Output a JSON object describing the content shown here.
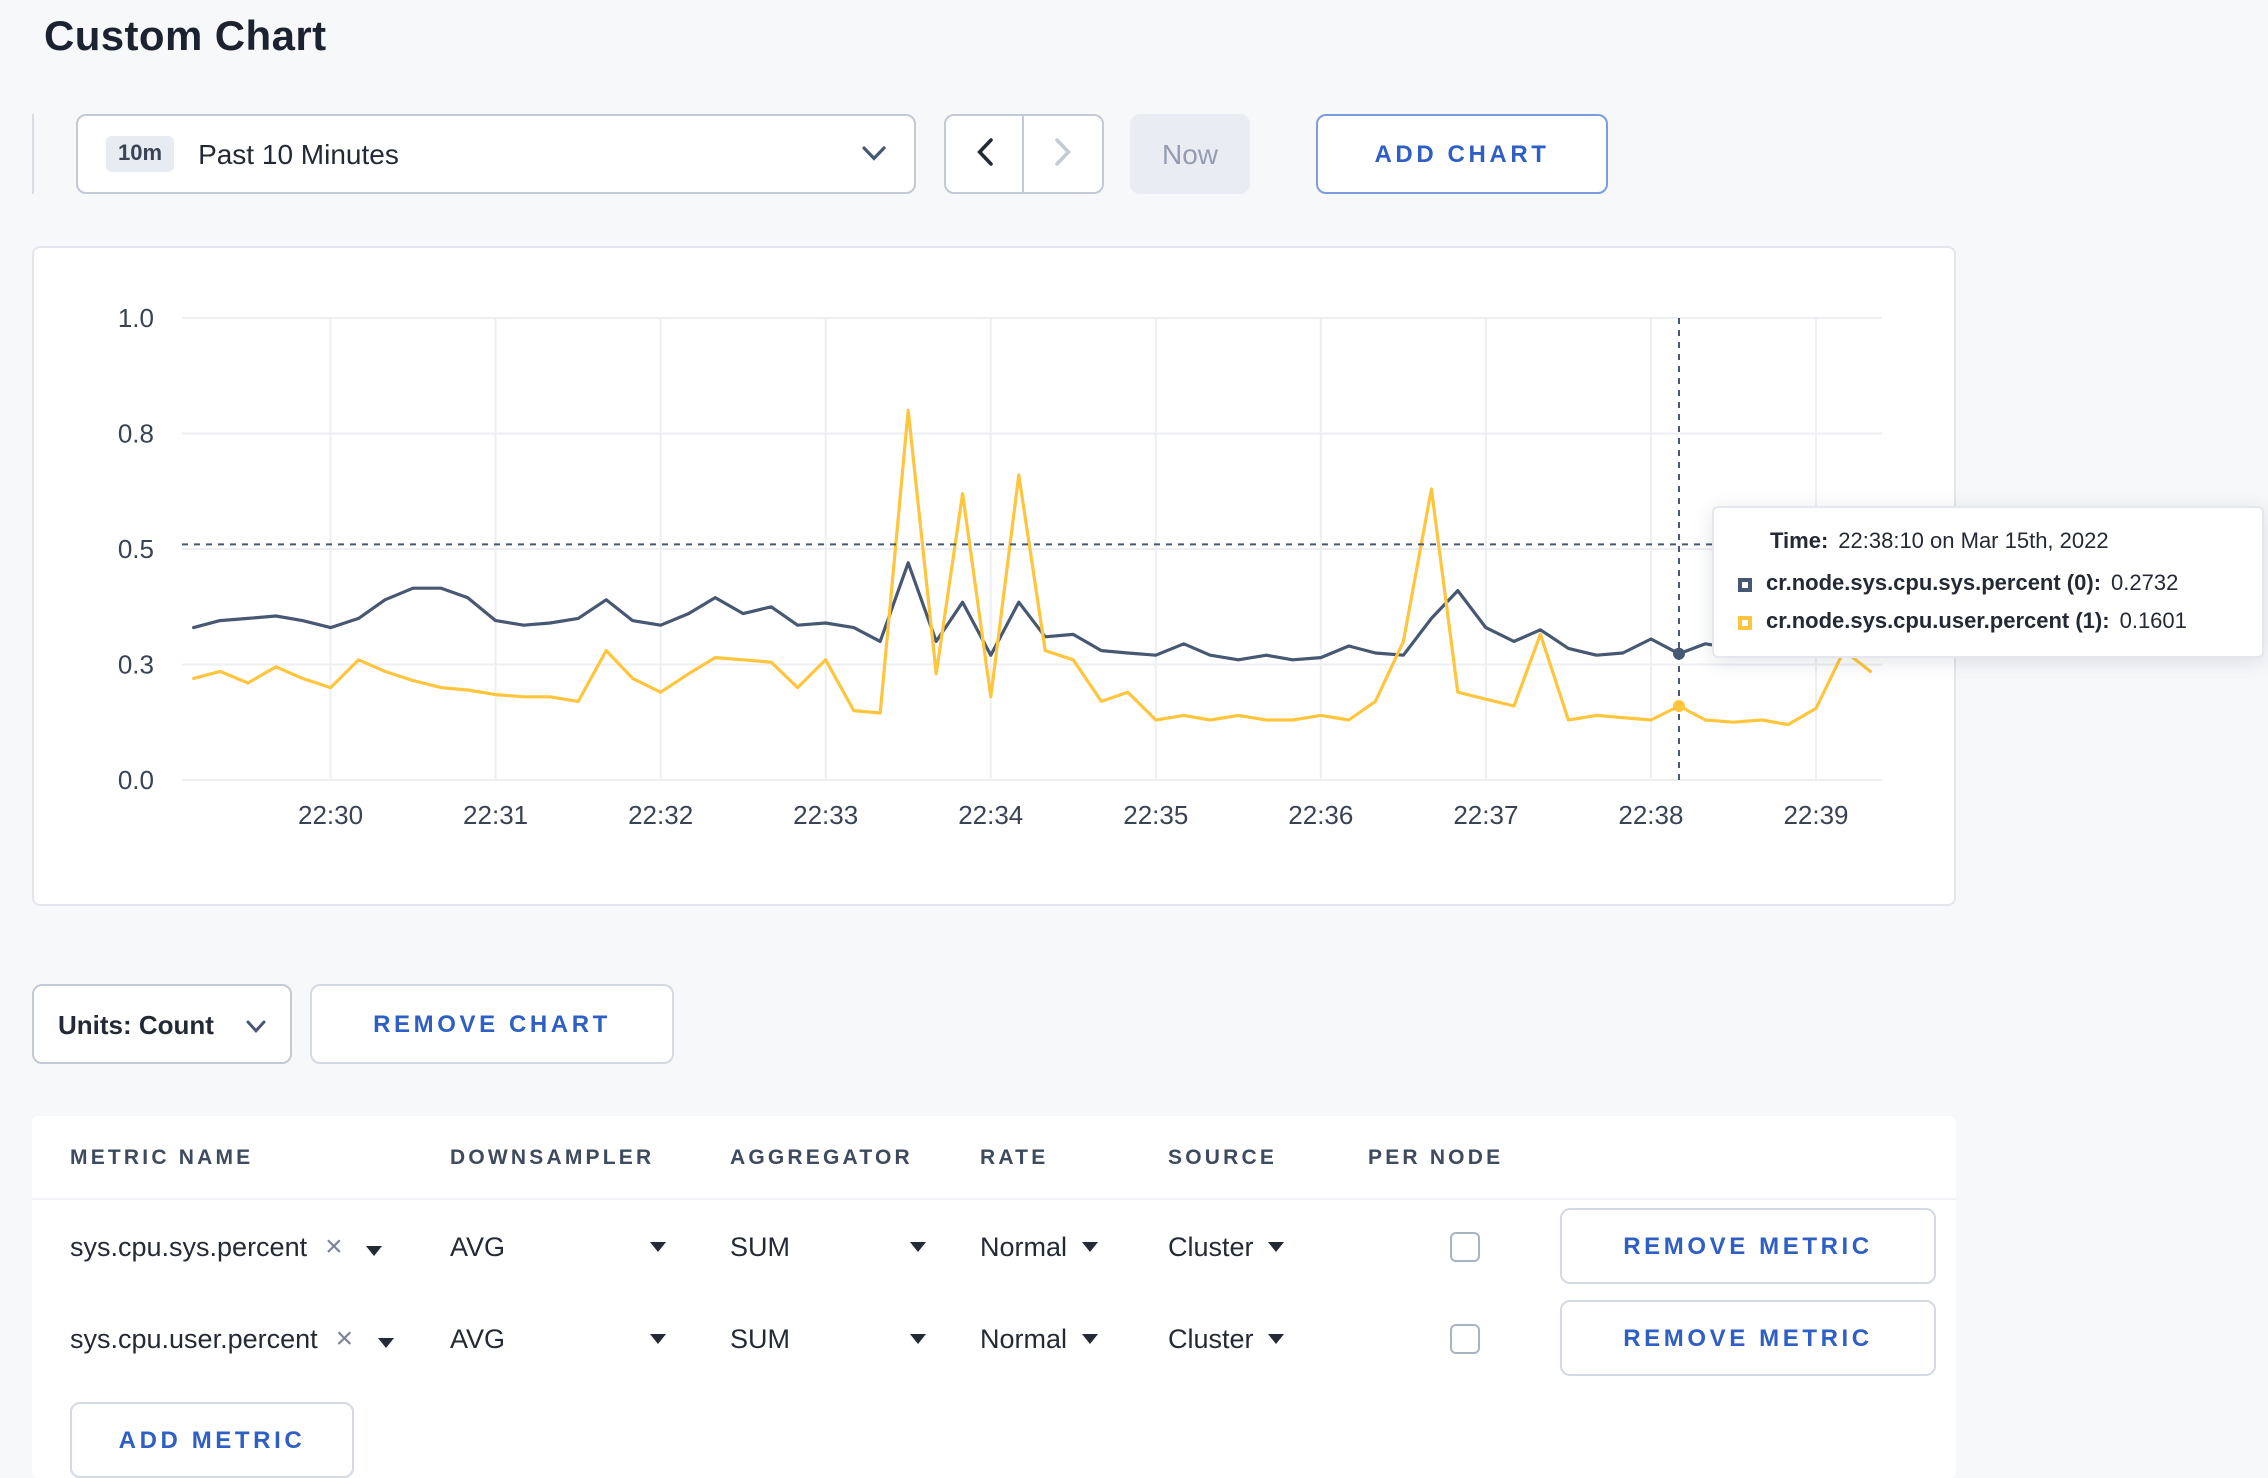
{
  "page": {
    "title": "Custom Chart"
  },
  "toolbar": {
    "time_badge": "10m",
    "time_label": "Past 10 Minutes",
    "now_label": "Now",
    "add_chart_label": "ADD CHART"
  },
  "chart_controls": {
    "units_label": "Units: Count",
    "remove_chart_label": "REMOVE CHART"
  },
  "tooltip": {
    "time_label": "Time:",
    "time_value": "22:38:10 on Mar 15th, 2022",
    "rows": [
      {
        "label": "cr.node.sys.cpu.sys.percent (0):",
        "value": "0.2732",
        "color": "#475872"
      },
      {
        "label": "cr.node.sys.cpu.user.percent (1):",
        "value": "0.1601",
        "color": "#ffc53d"
      }
    ]
  },
  "metrics_table": {
    "headers": [
      "METRIC NAME",
      "DOWNSAMPLER",
      "AGGREGATOR",
      "RATE",
      "SOURCE",
      "PER NODE"
    ],
    "rows": [
      {
        "metric": "sys.cpu.sys.percent",
        "downsampler": "AVG",
        "aggregator": "SUM",
        "rate": "Normal",
        "source": "Cluster",
        "per_node": false,
        "remove_label": "REMOVE METRIC"
      },
      {
        "metric": "sys.cpu.user.percent",
        "downsampler": "AVG",
        "aggregator": "SUM",
        "rate": "Normal",
        "source": "Cluster",
        "per_node": false,
        "remove_label": "REMOVE METRIC"
      }
    ],
    "add_metric_label": "ADD METRIC"
  },
  "colors": {
    "accent": "#2f5fc4",
    "series_sys": "#475872",
    "series_user": "#ffc53d"
  },
  "chart_data": {
    "type": "line",
    "title": "",
    "legend_position": "tooltip",
    "grid": true,
    "x_axis": {
      "tick_labels": [
        "22:30",
        "22:31",
        "22:32",
        "22:33",
        "22:34",
        "22:35",
        "22:36",
        "22:37",
        "22:38",
        "22:39"
      ],
      "tick_values": [
        30,
        31,
        32,
        33,
        34,
        35,
        36,
        37,
        38,
        39
      ],
      "range": [
        29.1,
        39.4
      ]
    },
    "y_axis": {
      "ticks": [
        {
          "v": 0,
          "label": "0.0"
        },
        {
          "v": 0.25,
          "label": "0.3"
        },
        {
          "v": 0.5,
          "label": "0.5"
        },
        {
          "v": 0.75,
          "label": "0.8"
        },
        {
          "v": 1,
          "label": "1.0"
        }
      ],
      "range": [
        0,
        1
      ]
    },
    "x_minutes": [
      29.17,
      29.33,
      29.5,
      29.67,
      29.83,
      30,
      30.17,
      30.33,
      30.5,
      30.67,
      30.83,
      31,
      31.17,
      31.33,
      31.5,
      31.67,
      31.83,
      32,
      32.17,
      32.33,
      32.5,
      32.67,
      32.83,
      33,
      33.17,
      33.33,
      33.5,
      33.67,
      33.83,
      34,
      34.17,
      34.33,
      34.5,
      34.67,
      34.83,
      35,
      35.17,
      35.33,
      35.5,
      35.67,
      35.83,
      36,
      36.17,
      36.33,
      36.5,
      36.67,
      36.83,
      37,
      37.17,
      37.33,
      37.5,
      37.67,
      37.83,
      38,
      38.17,
      38.33,
      38.5,
      38.67,
      38.83,
      39,
      39.17,
      39.33
    ],
    "series": [
      {
        "name": "cr.node.sys.cpu.sys.percent",
        "color": "#475872",
        "values": [
          0.33,
          0.345,
          0.35,
          0.355,
          0.345,
          0.33,
          0.35,
          0.39,
          0.415,
          0.415,
          0.395,
          0.345,
          0.335,
          0.34,
          0.35,
          0.39,
          0.345,
          0.335,
          0.36,
          0.395,
          0.36,
          0.375,
          0.335,
          0.34,
          0.33,
          0.3,
          0.47,
          0.3,
          0.385,
          0.27,
          0.385,
          0.31,
          0.315,
          0.28,
          0.275,
          0.27,
          0.295,
          0.27,
          0.26,
          0.27,
          0.26,
          0.265,
          0.29,
          0.275,
          0.27,
          0.35,
          0.41,
          0.33,
          0.3,
          0.325,
          0.285,
          0.27,
          0.275,
          0.305,
          0.2732,
          0.295,
          0.285,
          0.3,
          0.29,
          0.3,
          0.29,
          0.295
        ]
      },
      {
        "name": "cr.node.sys.cpu.user.percent",
        "color": "#ffc53d",
        "values": [
          0.22,
          0.235,
          0.21,
          0.245,
          0.22,
          0.2,
          0.26,
          0.235,
          0.215,
          0.2,
          0.195,
          0.185,
          0.18,
          0.18,
          0.17,
          0.28,
          0.22,
          0.19,
          0.23,
          0.265,
          0.26,
          0.255,
          0.2,
          0.26,
          0.15,
          0.145,
          0.8,
          0.23,
          0.62,
          0.18,
          0.66,
          0.28,
          0.26,
          0.17,
          0.19,
          0.13,
          0.14,
          0.13,
          0.14,
          0.13,
          0.13,
          0.14,
          0.13,
          0.17,
          0.3,
          0.63,
          0.19,
          0.175,
          0.16,
          0.315,
          0.13,
          0.14,
          0.135,
          0.13,
          0.1601,
          0.13,
          0.125,
          0.13,
          0.12,
          0.155,
          0.28,
          0.235
        ]
      }
    ],
    "crosshair": {
      "x": 38.17,
      "cursor_y_value": 0.51,
      "points": [
        {
          "series": 0,
          "value": 0.2732
        },
        {
          "series": 1,
          "value": 0.1601
        }
      ]
    }
  }
}
